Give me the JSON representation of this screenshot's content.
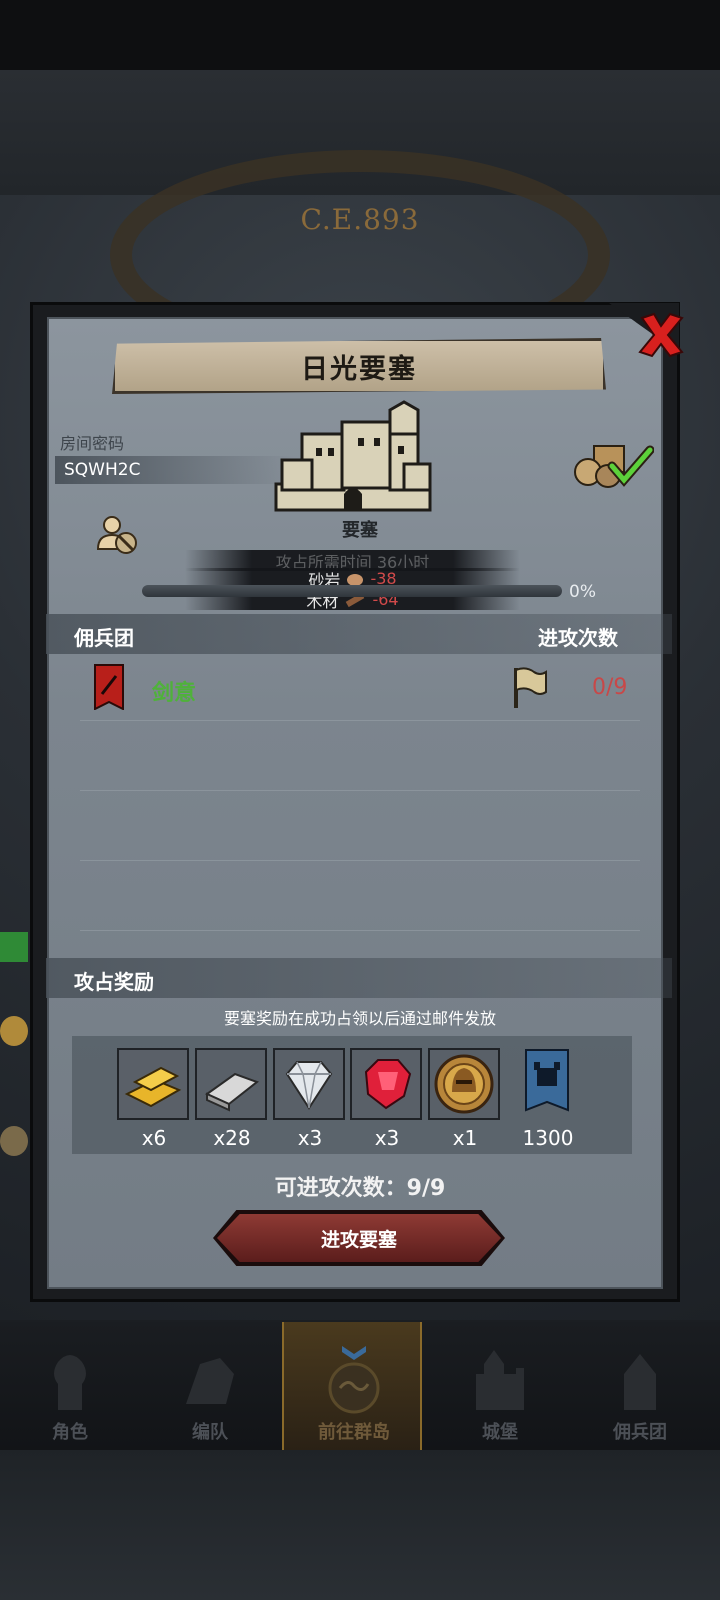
{
  "era": "C.E.893",
  "dialog": {
    "title": "日光要塞",
    "room_label": "房间密码",
    "room_code": "SQWH2C",
    "castle_label": "要塞",
    "cost_ghost_text": "攻占所需时间 36小时",
    "costs": [
      {
        "name": "砂岩",
        "icon": "stone-icon",
        "value": "-38"
      },
      {
        "name": "木材",
        "icon": "wood-icon",
        "value": "-64"
      }
    ],
    "progress": {
      "percent_value": 0,
      "text": "0%"
    },
    "mercenary_header": "佣兵团",
    "attack_count_header": "进攻次数",
    "mercenaries": [
      {
        "name": "剑意",
        "count": "0/9"
      }
    ],
    "reward_header": "攻占奖励",
    "reward_note": "要塞奖励在成功占领以后通过邮件发放",
    "rewards": [
      {
        "icon": "gold-bar-icon",
        "qty": "x6"
      },
      {
        "icon": "iron-bar-icon",
        "qty": "x28"
      },
      {
        "icon": "diamond-icon",
        "qty": "x3"
      },
      {
        "icon": "ruby-icon",
        "qty": "x3"
      },
      {
        "icon": "helmet-medal-icon",
        "qty": "x1"
      },
      {
        "icon": "fortress-banner-icon",
        "qty": "1300"
      }
    ],
    "attacks_left": "可进攻次数：9/9",
    "attack_button": "进攻要塞"
  },
  "nav": [
    {
      "label": "角色",
      "icon": "knight-icon",
      "active": false
    },
    {
      "label": "编队",
      "icon": "formation-icon",
      "active": false
    },
    {
      "label": "前往群岛",
      "icon": "islands-icon",
      "active": true
    },
    {
      "label": "城堡",
      "icon": "castle-icon",
      "active": false
    },
    {
      "label": "佣兵团",
      "icon": "mercenary-icon",
      "active": false
    }
  ],
  "colors": {
    "mercenary_name": "#4fb23a",
    "negative_value": "#d24a4a",
    "attack_button": "#8e3a34",
    "close_x": "#d8201e"
  }
}
